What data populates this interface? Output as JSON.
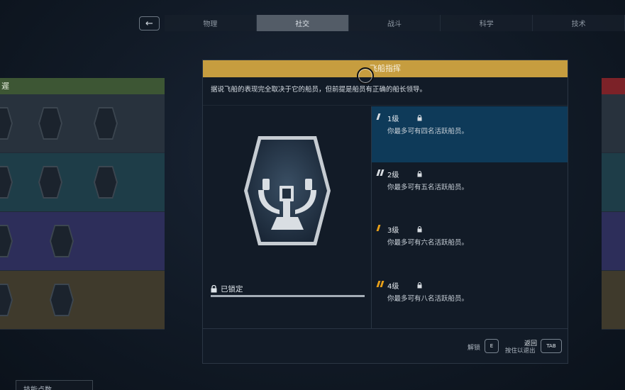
{
  "nav": {
    "back_glyph": "←",
    "tabs": [
      {
        "label": "物理",
        "active": false
      },
      {
        "label": "社交",
        "active": true
      },
      {
        "label": "战斗",
        "active": false
      },
      {
        "label": "科学",
        "active": false
      },
      {
        "label": "技术",
        "active": false
      }
    ]
  },
  "skill_tree": {
    "left_header_fragment": "遲",
    "bottom_label": "技能点数"
  },
  "dialog": {
    "title": "飞船指挥",
    "description": "据说飞船的表现完全取决于它的船员，但前提是船员有正确的船长领导。",
    "locked_label": "已锁定",
    "ranks": [
      {
        "label": "1级",
        "desc": "你最多可有四名活跃船员。",
        "pips": 1,
        "pip_color": "#d8dde2"
      },
      {
        "label": "2级",
        "desc": "你最多可有五名活跃船员。",
        "pips": 2,
        "pip_color": "#d8dde2"
      },
      {
        "label": "3级",
        "desc": "你最多可有六名活跃船员。",
        "pips": 1,
        "pip_color": "#e8a019"
      },
      {
        "label": "4级",
        "desc": "你最多可有八名活跃船员。",
        "pips": 2,
        "pip_color": "#e8a019"
      }
    ],
    "footer": {
      "unlock_label": "解锁",
      "unlock_key": "E",
      "back_label": "返回",
      "back_hint": "按住以退出",
      "back_key": "TAB"
    }
  },
  "colors": {
    "title_bar": "#c69d3f",
    "selected_rank": "#0e3a59",
    "social_header": "#3d5634",
    "right_header": "#7c2228"
  }
}
